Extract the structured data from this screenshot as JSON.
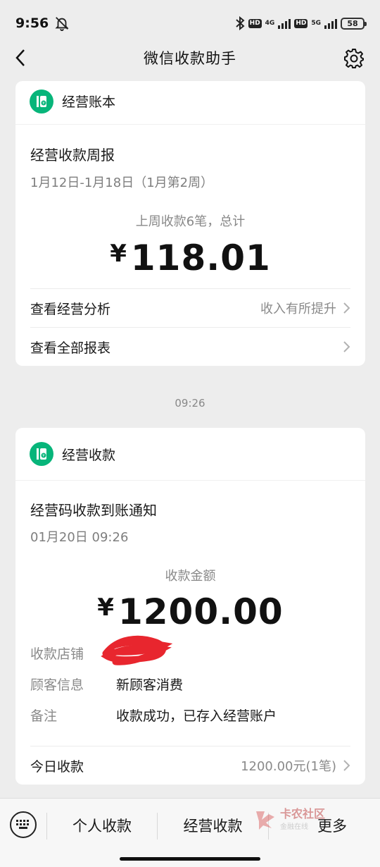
{
  "status_bar": {
    "time": "9:56",
    "network1": "4G",
    "network2": "5G",
    "hd": "HD",
    "battery": "58"
  },
  "nav": {
    "title": "微信收款助手"
  },
  "card1": {
    "header_title": "经营账本",
    "title": "经营收款周报",
    "subtitle": "1月12日-1月18日（1月第2周）",
    "summary_label": "上周收款6笔，总计",
    "currency": "¥",
    "amount": "118.01",
    "rows": [
      {
        "label": "查看经营分析",
        "value": "收入有所提升"
      },
      {
        "label": "查看全部报表",
        "value": ""
      }
    ]
  },
  "timestamp": "09:26",
  "card2": {
    "header_title": "经营收款",
    "title": "经营码收款到账通知",
    "subtitle": "01月20日 09:26",
    "amount_label": "收款金额",
    "currency": "¥",
    "amount": "1200.00",
    "info": [
      {
        "key": "收款店铺",
        "value": ""
      },
      {
        "key": "顾客信息",
        "value": "新顾客消费"
      },
      {
        "key": "备注",
        "value": "收款成功，已存入经营账户"
      }
    ],
    "today_label": "今日收款",
    "today_value": "1200.00元(1笔)"
  },
  "bottom_menu": {
    "tabs": [
      "个人收款",
      "经营收款",
      "更多"
    ]
  },
  "watermark": {
    "text": "卡农社区",
    "sub": "金融在线"
  },
  "colors": {
    "accent": "#07b57a",
    "background": "#ededed",
    "redaction": "#e8262e"
  }
}
